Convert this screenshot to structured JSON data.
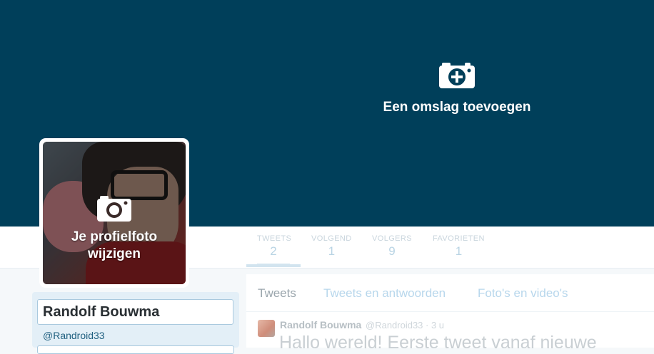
{
  "cover": {
    "label": "Een omslag toevoegen"
  },
  "avatar": {
    "label_line1": "Je profielfoto",
    "label_line2": "wijzigen"
  },
  "stats": [
    {
      "label": "TWEETS",
      "value": "2"
    },
    {
      "label": "VOLGEND",
      "value": "1"
    },
    {
      "label": "VOLGERS",
      "value": "9"
    },
    {
      "label": "FAVORIETEN",
      "value": "1"
    }
  ],
  "profile": {
    "name": "Randolf Bouwma",
    "handle": "@Randroid33"
  },
  "tabs": [
    "Tweets",
    "Tweets en antwoorden",
    "Foto's en video's"
  ],
  "tweet": {
    "name": "Randolf Bouwma",
    "meta": "@Randroid33 · 3 u",
    "text": "Hallo wereld! Eerste tweet vanaf nieuwe"
  },
  "colors": {
    "cover": "#003f5a",
    "accent": "#1f5f7f"
  },
  "icons": {
    "cover": "camera-plus-icon",
    "avatar": "camera-icon"
  }
}
